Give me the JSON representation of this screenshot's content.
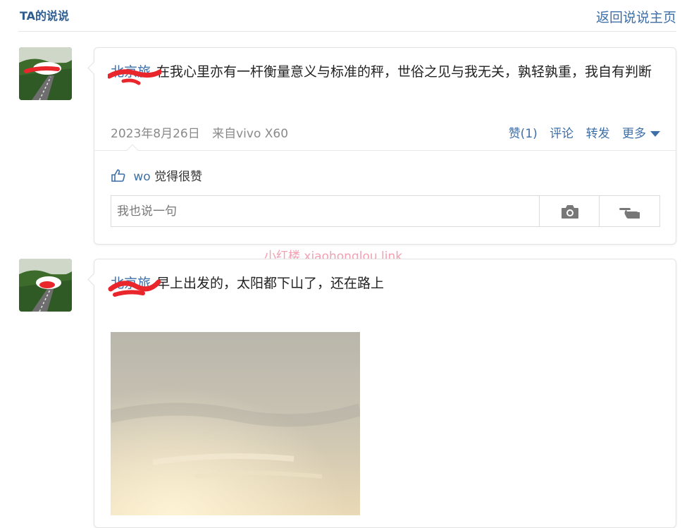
{
  "header": {
    "title": "TA的说说",
    "back_link": "返回说说主页"
  },
  "posts": [
    {
      "author": "北京旅",
      "text": "在我心里亦有一杆衡量意义与标准的秤，世俗之见与我无关，孰轻孰重，我自有判断",
      "date": "2023年8月26日",
      "source": "来自vivo X60",
      "actions": {
        "like": "赞(1)",
        "comment": "评论",
        "forward": "转发",
        "more": "更多"
      },
      "likes": {
        "user": "wo",
        "suffix": "觉得很赞"
      },
      "comment_placeholder": "我也说一句"
    },
    {
      "author": "北京旅",
      "text": "早上出发的，太阳都下山了，还在路上"
    }
  ],
  "watermark": "小红楼  xiaohonglou.link",
  "icons": [
    "thumbs-up-icon",
    "camera-icon",
    "pointing-hand-icon"
  ],
  "colors": {
    "link": "#3e6fa8",
    "title": "#2f5c8f",
    "redaction": "#e8262b"
  }
}
